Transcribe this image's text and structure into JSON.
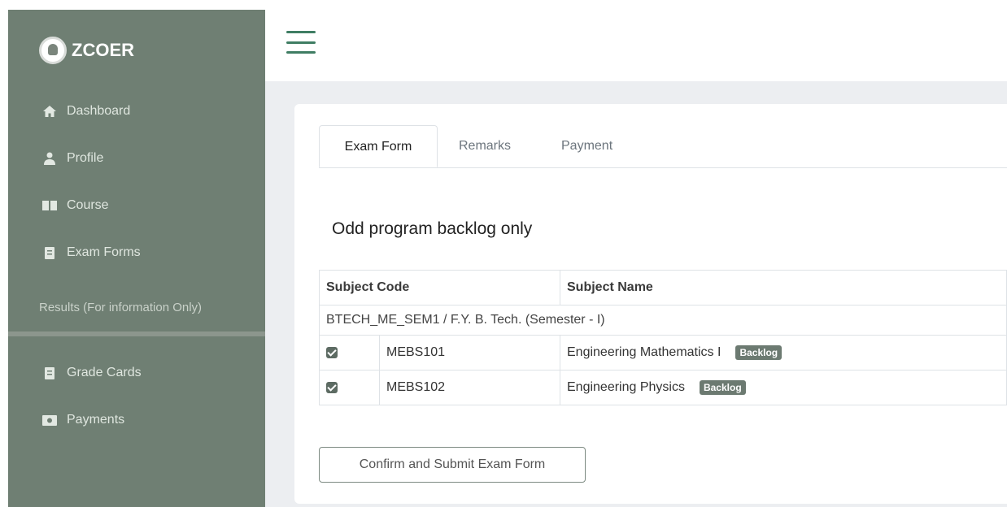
{
  "sidebar": {
    "brand": "ZCOER",
    "items": [
      {
        "label": "Dashboard",
        "icon": "home-icon"
      },
      {
        "label": "Profile",
        "icon": "user-icon"
      },
      {
        "label": "Course",
        "icon": "book-icon"
      },
      {
        "label": "Exam Forms",
        "icon": "document-icon"
      }
    ],
    "section_label": "Results (For information Only)",
    "items2": [
      {
        "label": "Grade Cards",
        "icon": "document-icon"
      },
      {
        "label": "Payments",
        "icon": "money-icon"
      }
    ]
  },
  "tabs": [
    "Exam Form",
    "Remarks",
    "Payment"
  ],
  "heading": "Odd program backlog only",
  "table": {
    "headers": [
      "Subject Code",
      "Subject Name"
    ],
    "group_label": "BTECH_ME_SEM1 / F.Y. B. Tech. (Semester - I)",
    "rows": [
      {
        "code": "MEBS101",
        "name": "Engineering Mathematics I",
        "badge": "Backlog",
        "checked": true
      },
      {
        "code": "MEBS102",
        "name": "Engineering Physics",
        "badge": "Backlog",
        "checked": true
      }
    ]
  },
  "submit_label": "Confirm and Submit Exam Form",
  "colors": {
    "sidebar_bg": "#6f7f73",
    "accent": "#3f7d63",
    "badge": "#6c7a71"
  }
}
